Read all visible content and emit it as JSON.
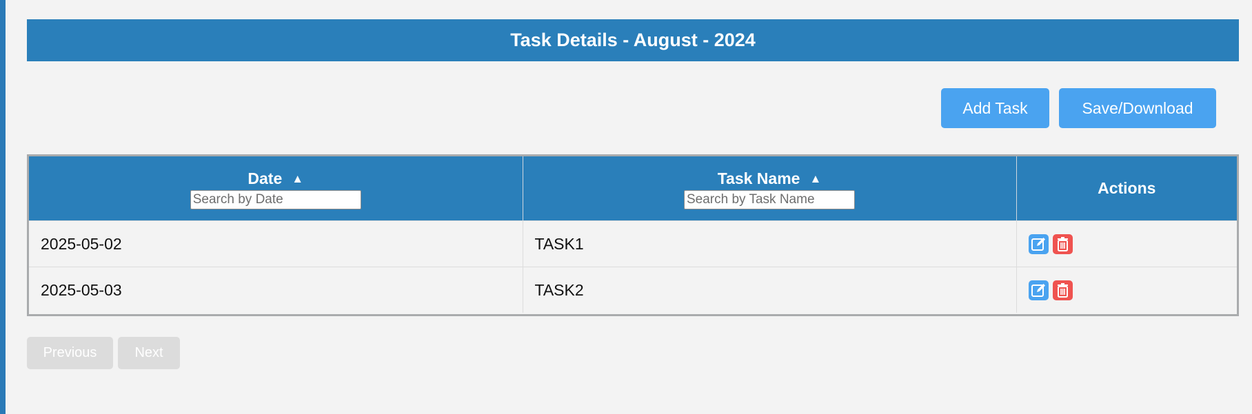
{
  "page": {
    "title": "Task Details - August - 2024"
  },
  "toolbar": {
    "add_label": "Add Task",
    "save_label": "Save/Download"
  },
  "table": {
    "columns": [
      {
        "label": "Date",
        "sort_icon": "▲",
        "search_placeholder": "Search by Date"
      },
      {
        "label": "Task Name",
        "sort_icon": "▲",
        "search_placeholder": "Search by Task Name"
      },
      {
        "label": "Actions"
      }
    ],
    "rows": [
      {
        "date": "2025-05-02",
        "task": "TASK1",
        "actions": [
          "edit-icon",
          "delete-icon"
        ]
      },
      {
        "date": "2025-05-03",
        "task": "TASK2",
        "actions": [
          "edit-icon",
          "delete-icon"
        ]
      }
    ]
  },
  "pagination": {
    "prev_label": "Previous",
    "next_label": "Next"
  },
  "colors": {
    "header_blue": "#2a7fba",
    "button_blue": "#4aa3f0",
    "edit_blue": "#4aa3f0",
    "delete_red": "#ef5350",
    "disabled_gray": "#dcdcdc",
    "background": "#f3f3f3"
  }
}
